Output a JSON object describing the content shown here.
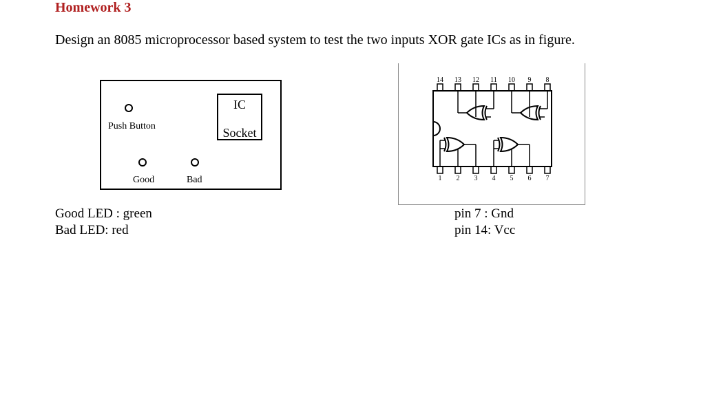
{
  "title": "Homework 3",
  "description": "Design an 8085 microprocessor based system to test the two inputs XOR gate ICs as in figure.",
  "panel": {
    "push_button_label": "Push Button",
    "ic_label": "IC",
    "socket_label": "Socket",
    "good_label": "Good",
    "bad_label": "Bad"
  },
  "led_info": {
    "good": "Good LED : green",
    "bad": "Bad LED: red"
  },
  "pin_info": {
    "pin7": "pin 7  : Gnd",
    "pin14": "pin 14: Vcc"
  },
  "ic_pins": {
    "top": [
      "14",
      "13",
      "12",
      "11",
      "10",
      "9",
      "8"
    ],
    "bottom": [
      "1",
      "2",
      "3",
      "4",
      "5",
      "6",
      "7"
    ]
  }
}
